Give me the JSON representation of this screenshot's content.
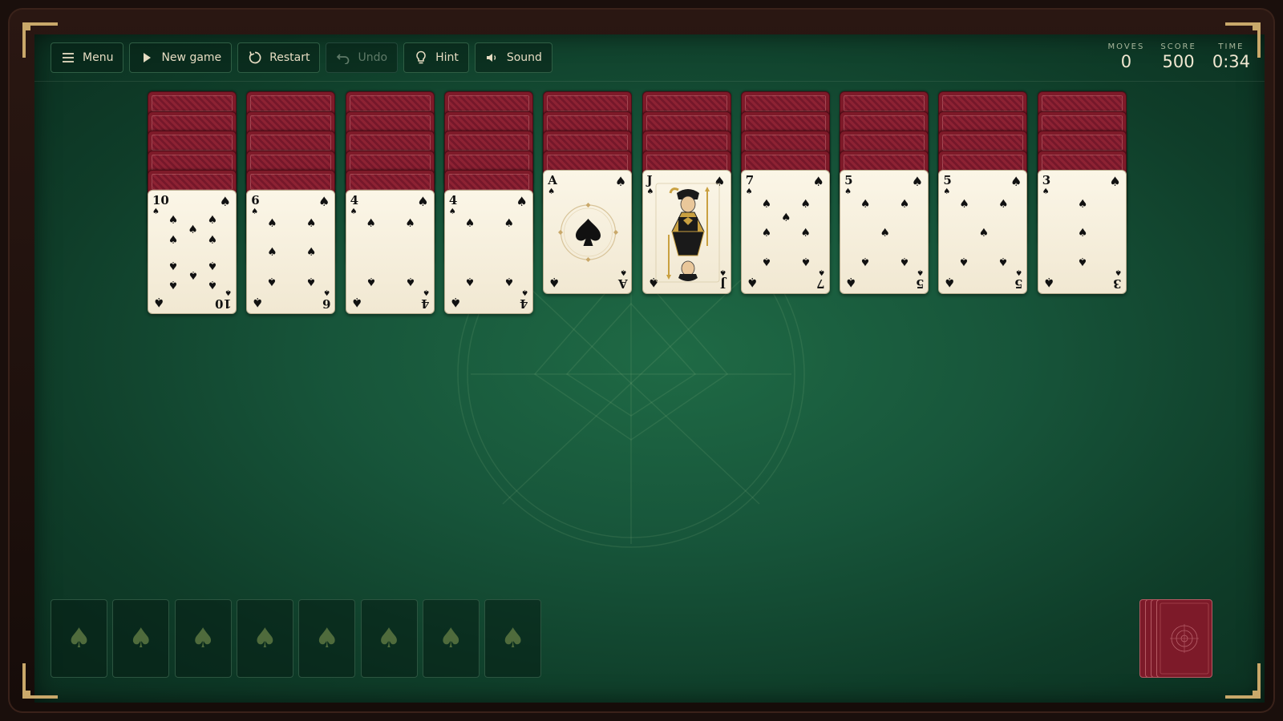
{
  "toolbar": {
    "menu": "Menu",
    "new_game": "New game",
    "restart": "Restart",
    "undo": "Undo",
    "hint": "Hint",
    "sound": "Sound"
  },
  "stats": {
    "moves_label": "MOVES",
    "moves": "0",
    "score_label": "SCORE",
    "score": "500",
    "time_label": "TIME",
    "time": "0:34"
  },
  "tableau": [
    {
      "facedown": 5,
      "rank": "10",
      "suit": "♠"
    },
    {
      "facedown": 5,
      "rank": "6",
      "suit": "♠"
    },
    {
      "facedown": 5,
      "rank": "4",
      "suit": "♠"
    },
    {
      "facedown": 5,
      "rank": "4",
      "suit": "♠"
    },
    {
      "facedown": 4,
      "rank": "A",
      "suit": "♠"
    },
    {
      "facedown": 4,
      "rank": "J",
      "suit": "♠"
    },
    {
      "facedown": 4,
      "rank": "7",
      "suit": "♠"
    },
    {
      "facedown": 4,
      "rank": "5",
      "suit": "♠"
    },
    {
      "facedown": 4,
      "rank": "5",
      "suit": "♠"
    },
    {
      "facedown": 4,
      "rank": "3",
      "suit": "♠"
    }
  ],
  "foundations": {
    "count": 8,
    "placeholder_suit": "♠"
  },
  "stock": {
    "stacked_cards": 4
  },
  "colors": {
    "felt": "#17553a",
    "card_back": "#7e1a29",
    "frame_accent": "#c9a86a"
  }
}
